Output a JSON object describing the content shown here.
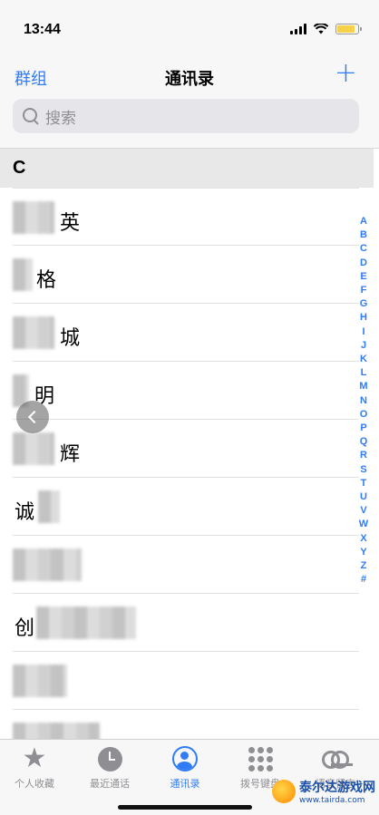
{
  "status_bar": {
    "time": "13:44"
  },
  "nav": {
    "groups_label": "群组",
    "title": "通讯录",
    "add_label": "+"
  },
  "search": {
    "placeholder": "搜索"
  },
  "section": {
    "letter": "C"
  },
  "contacts": [
    {
      "visible_text": "英"
    },
    {
      "visible_text": "格"
    },
    {
      "visible_text": "城"
    },
    {
      "visible_text": "明"
    },
    {
      "visible_text": "辉"
    },
    {
      "visible_text": "诚"
    },
    {
      "visible_text": ""
    },
    {
      "visible_text": "创"
    },
    {
      "visible_text": ""
    },
    {
      "visible_text": ""
    }
  ],
  "index_letters": [
    "A",
    "B",
    "C",
    "D",
    "E",
    "F",
    "G",
    "H",
    "I",
    "J",
    "K",
    "L",
    "M",
    "N",
    "O",
    "P",
    "Q",
    "R",
    "S",
    "T",
    "U",
    "V",
    "W",
    "X",
    "Y",
    "Z",
    "#"
  ],
  "tabs": [
    {
      "label": "个人收藏",
      "icon": "star-icon"
    },
    {
      "label": "最近通话",
      "icon": "clock-icon"
    },
    {
      "label": "通讯录",
      "icon": "person-circle-icon",
      "active": true
    },
    {
      "label": "拨号键盘",
      "icon": "keypad-icon"
    },
    {
      "label": "语音留言",
      "icon": "voicemail-icon"
    }
  ],
  "watermark": {
    "name": "泰尔达游戏网",
    "url": "www.tairda.com"
  },
  "colors": {
    "accent": "#2f7cf6",
    "section_bg": "#e8e8e8",
    "bar_bg": "#f7f7f7"
  }
}
